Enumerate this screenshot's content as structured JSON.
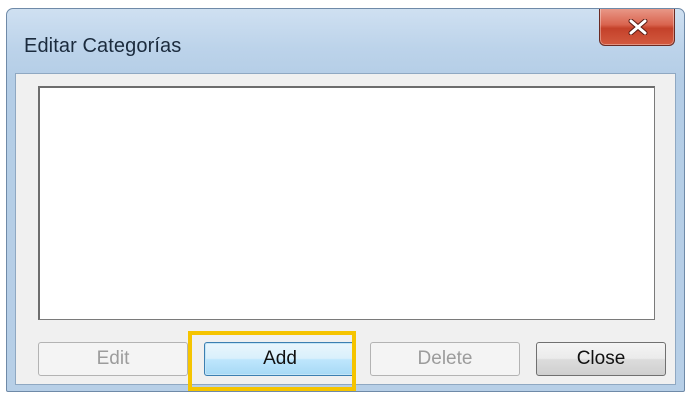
{
  "window": {
    "title": "Editar Categorías"
  },
  "buttons": {
    "edit_label": "Edit",
    "add_label": "Add",
    "delete_label": "Delete",
    "close_label": "Close"
  },
  "list": {
    "items": []
  },
  "colors": {
    "highlight": "#f5c400",
    "close_button": "#c4412a",
    "frame": "#b7cfe7"
  },
  "icons": {
    "close": "close-icon"
  }
}
